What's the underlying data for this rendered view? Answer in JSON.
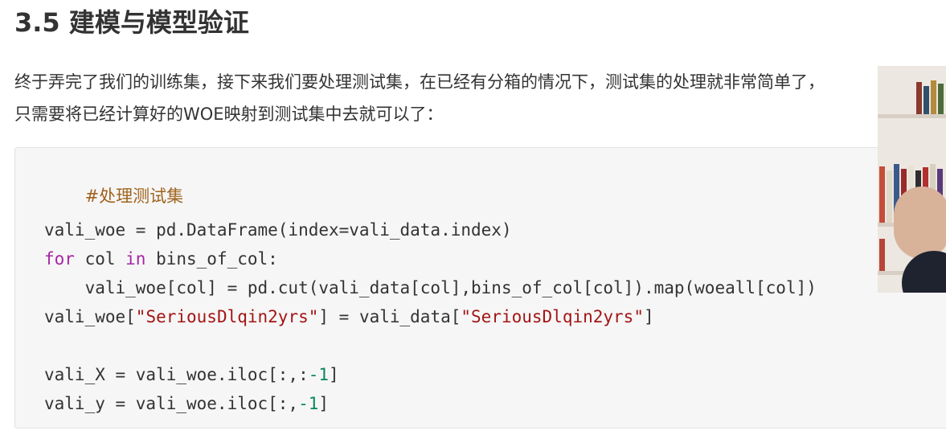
{
  "section": {
    "title": "3.5 建模与模型验证"
  },
  "paragraph": {
    "line1": "终于弄完了我们的训练集，接下来我们要处理测试集，在已经有分箱的情况下，测试集的处理就非常简单了，",
    "line2": "只需要将已经计算好的WOE映射到测试集中去就可以了："
  },
  "code": {
    "comment": "#处理测试集",
    "line1": "vali_woe = pd.DataFrame(index=vali_data.index)",
    "line2_kw1": "for",
    "line2_mid": " col ",
    "line2_kw2": "in",
    "line2_end": " bins_of_col:",
    "line3": "    vali_woe[col] = pd.cut(vali_data[col],bins_of_col[col]).map(woeall[col])",
    "line4_a": "vali_woe[",
    "line4_str1": "\"SeriousDlqin2yrs\"",
    "line4_b": "] = vali_data[",
    "line4_str2": "\"SeriousDlqin2yrs\"",
    "line4_c": "]",
    "line5_a": "vali_X = vali_woe.iloc[:,:",
    "line5_num": "-1",
    "line5_b": "]",
    "line6_a": "vali_y = vali_woe.iloc[:,",
    "line6_num": "-1",
    "line6_b": "]"
  },
  "colors": {
    "comment": "#a0621e",
    "keyword": "#a626a4",
    "string": "#a31515",
    "number": "#098658"
  }
}
